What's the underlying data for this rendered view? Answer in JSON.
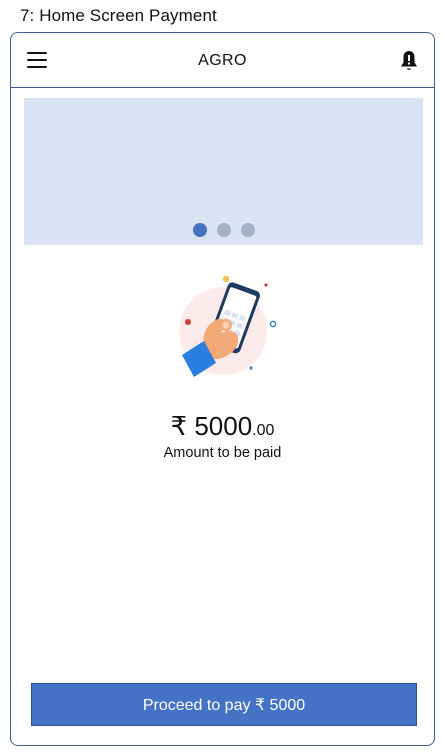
{
  "caption": "7: Home Screen Payment",
  "header": {
    "title": "AGRO",
    "menu_icon": "hamburger-menu-icon",
    "notification_icon": "bell-alert-icon"
  },
  "banner": {
    "slides": 3,
    "active_slide": 1,
    "background_color": "#dae3f4",
    "dot_active_color": "#4472c4",
    "dot_inactive_color": "#a4b1c6"
  },
  "payment": {
    "illustration": "hand-holding-phone-payment-illustration",
    "amount_main": "₹ 5000",
    "amount_decimal": ".00",
    "amount_label": "Amount to be paid"
  },
  "actions": {
    "pay_button_label": "Proceed to pay ₹ 5000",
    "pay_button_color": "#4472c4"
  }
}
